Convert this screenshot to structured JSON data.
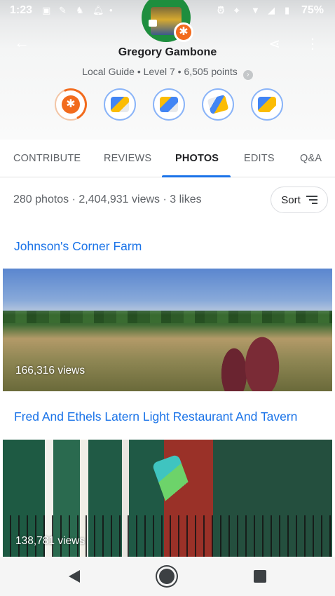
{
  "status_bar": {
    "time": "1:23",
    "battery": "75%"
  },
  "profile": {
    "name": "Gregory Gambone",
    "subtitle": "Local Guide • Level 7 • 6,505 points",
    "badges": [
      "star-badge",
      "review-badge",
      "photo-badge",
      "edit-badge",
      "qa-badge"
    ]
  },
  "tabs": [
    {
      "label": "CONTRIBUTE",
      "active": false
    },
    {
      "label": "REVIEWS",
      "active": false
    },
    {
      "label": "PHOTOS",
      "active": true
    },
    {
      "label": "EDITS",
      "active": false
    },
    {
      "label": "Q&A",
      "active": false
    }
  ],
  "stats": {
    "summary": "280 photos · 2,404,931 views · 3 likes",
    "sort_label": "Sort"
  },
  "places": [
    {
      "title": "Johnson's Corner Farm",
      "views": "166,316 views"
    },
    {
      "title": "Fred And Ethels Latern Light Restaurant And Tavern",
      "views": "138,781 views"
    }
  ],
  "colors": {
    "accent": "#1a73e8",
    "badge_orange": "#f26b1d",
    "avatar_ring": "#1e8e3e"
  }
}
